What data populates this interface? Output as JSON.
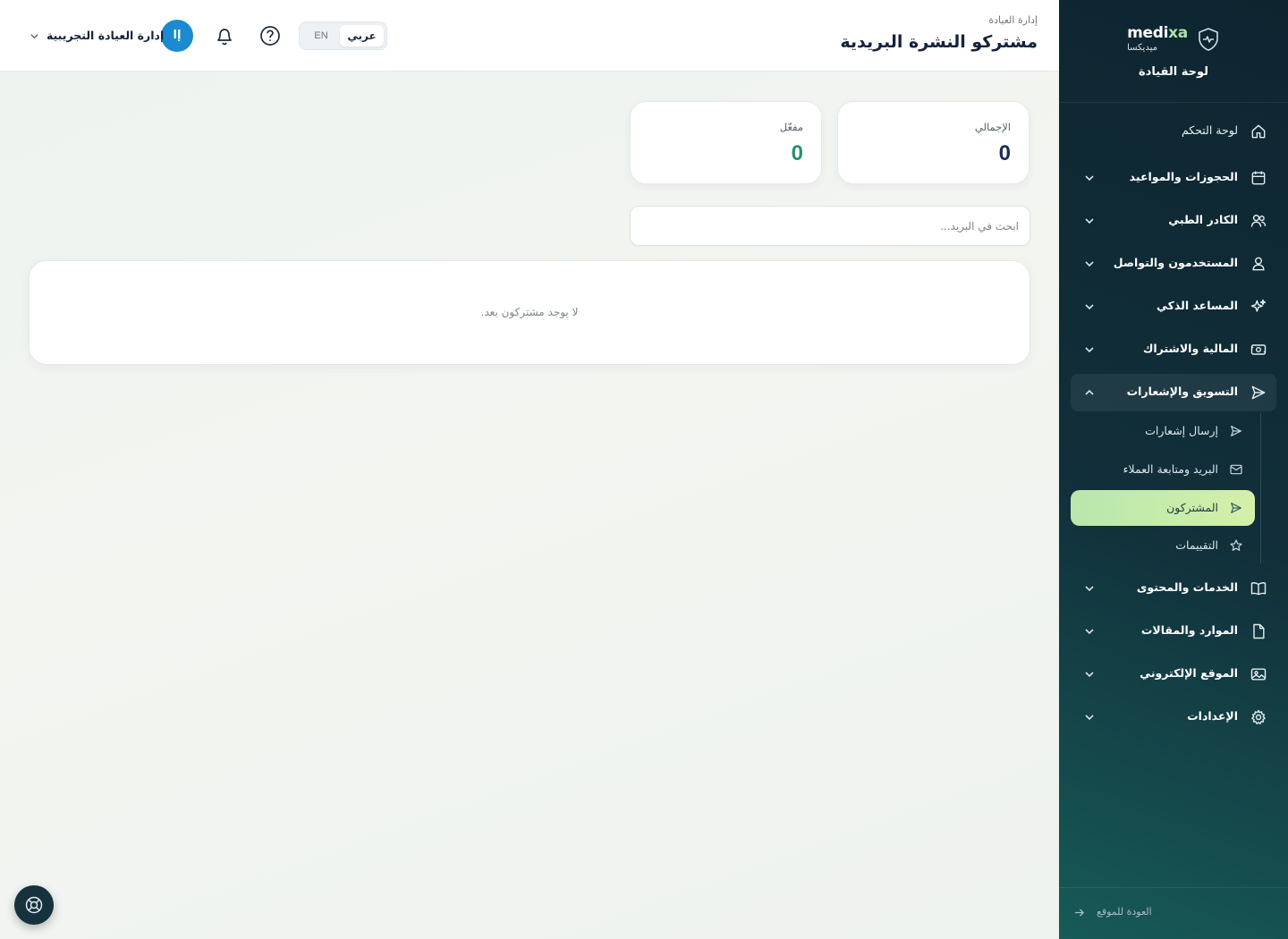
{
  "brand": {
    "name_latin_main": "medi",
    "name_latin_accent": "xa",
    "name_arabic": "ميديكسا",
    "section": "لوحة القيادة"
  },
  "sidebar": {
    "items": [
      {
        "label": "لوحة التحكم",
        "icon": "home-icon",
        "expandable": false
      },
      {
        "label": "الحجوزات والمواعيد",
        "icon": "calendar-icon",
        "expandable": true
      },
      {
        "label": "الكادر الطبي",
        "icon": "users-icon",
        "expandable": true
      },
      {
        "label": "المستخدمون والتواصل",
        "icon": "user-icon",
        "expandable": true
      },
      {
        "label": "المساعد الذكي",
        "icon": "sparkles-icon",
        "expandable": true
      },
      {
        "label": "المالية والاشتراك",
        "icon": "banknote-icon",
        "expandable": true
      },
      {
        "label": "التسويق والإشعارات",
        "icon": "send-icon",
        "expandable": true,
        "open": true
      },
      {
        "label": "الخدمات والمحتوى",
        "icon": "book-icon",
        "expandable": true
      },
      {
        "label": "الموارد والمقالات",
        "icon": "file-icon",
        "expandable": true
      },
      {
        "label": "الموقع الإلكتروني",
        "icon": "image-icon",
        "expandable": true
      },
      {
        "label": "الإعدادات",
        "icon": "gear-icon",
        "expandable": true
      }
    ],
    "subitems": [
      {
        "label": "إرسال إشعارات",
        "icon": "send-icon"
      },
      {
        "label": "البريد ومتابعة العملاء",
        "icon": "mail-icon"
      },
      {
        "label": "المشتركون",
        "icon": "send-icon",
        "active": true
      },
      {
        "label": "التقييمات",
        "icon": "star-icon"
      }
    ],
    "back_label": "العودة للموقع"
  },
  "header": {
    "breadcrumb": "إدارة العيادة",
    "title": "مشتركو النشرة البريدية",
    "lang_ar": "عربي",
    "lang_en": "EN",
    "user_initials": "إا",
    "user_name": "إدارة العيادة التجريبية"
  },
  "stats": {
    "total_label": "الإجمالي",
    "total_value": "0",
    "enabled_label": "مفعّل",
    "enabled_value": "0"
  },
  "search": {
    "placeholder": "ابحث في البريد...",
    "value": ""
  },
  "empty_state": "لا يوجد مشتركون بعد.",
  "colors": {
    "sidebar_dark": "#0e2530",
    "active_item": "#c8ecab",
    "avatar": "#1b8ad0",
    "total_value": "#1a2d55",
    "enabled_value": "#24926e"
  }
}
